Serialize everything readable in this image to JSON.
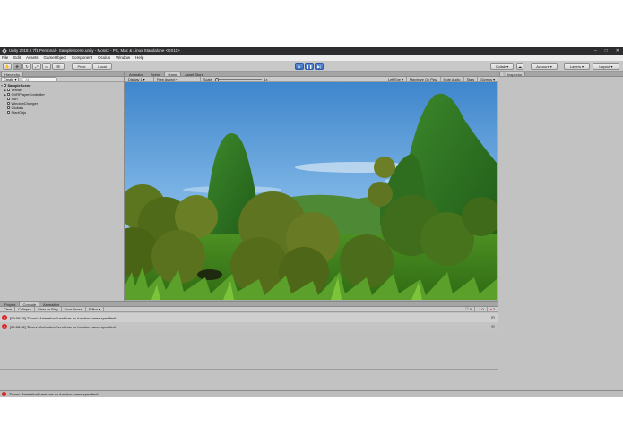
{
  "window": {
    "title": "Unity 2018.2.7f1 Personal - SampleScene.unity - Moss2 - PC, Mac & Linux Standalone <DX11>",
    "controls": [
      "–",
      "□",
      "✕"
    ]
  },
  "menu": [
    "File",
    "Edit",
    "Assets",
    "GameObject",
    "Component",
    "Oculus",
    "Window",
    "Help"
  ],
  "toolbar": {
    "tools": [
      "hand-tool",
      "move-tool",
      "rotate-tool",
      "scale-tool",
      "rect-tool",
      "transform-tool"
    ],
    "pivot_label": "Pivot",
    "local_label": "Local",
    "right": [
      "Collab ▾",
      "Account ▾",
      "Layers ▾",
      "Layout ▾"
    ]
  },
  "hierarchy": {
    "tab": "Hierarchy",
    "create_label": "Create ▾",
    "search_placeholder": "All",
    "scene": "SampleScene",
    "items": [
      "Terrain",
      "OVRPlayerController",
      "Sun",
      "WindowChanger",
      "Globals",
      "StartObjs"
    ]
  },
  "center_tabs": [
    "Animator",
    "Scene",
    "Game",
    "Asset Store"
  ],
  "gamebar": {
    "display": "Display 1 ▾",
    "aspect": "Free Aspect ▾",
    "scale_label": "Scale",
    "scale_value": "1x",
    "right": [
      "Left Eye ▾",
      "Maximize On Play",
      "Mute Audio",
      "Stats",
      "Gizmos ▾"
    ]
  },
  "inspector": {
    "tab": "Inspector"
  },
  "bottom_tabs": [
    "Project",
    "Console",
    "Animation"
  ],
  "console": {
    "buttons": [
      "Clear",
      "Collapse",
      "Clear on Play",
      "Error Pause",
      "Editor ▾"
    ],
    "counts": [
      "0",
      "0",
      "2"
    ],
    "messages": [
      {
        "text": "[09:58:28] 'Doors': AnimationEvent has no function name specified!",
        "count": "1"
      },
      {
        "text": "[09:58:32] 'Doors': AnimationEvent has no function name specified!",
        "count": "1"
      }
    ]
  },
  "status": {
    "text": "'Doors': AnimationEvent has no function name specified!"
  },
  "colors": {
    "sky": "#4a8fd0",
    "foliage": "#3f7a1f",
    "error": "#d22222",
    "play_active": "#3d6fc0"
  }
}
